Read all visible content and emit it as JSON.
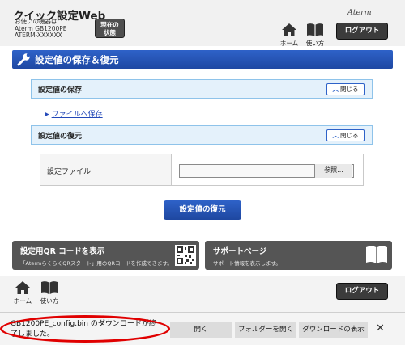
{
  "header": {
    "title": "クイック設定Web",
    "device_line1": "お使いの機器は",
    "device_line2": "Aterm GB1200PE",
    "device_line3": "ATERM-XXXXXX",
    "status_line1": "現在の",
    "status_line2": "状態",
    "home_label": "ホーム",
    "manual_label": "使い方",
    "brand": "Aterm",
    "logout_label": "ログアウト"
  },
  "panel": {
    "title": "設定値の保存＆復元"
  },
  "save_section": {
    "title": "設定値の保存",
    "close_label": "閉じる",
    "link": "ファイルへ保存"
  },
  "restore_section": {
    "title": "設定値の復元",
    "close_label": "閉じる",
    "file_label": "設定ファイル",
    "file_value": "",
    "browse_label": "参照...",
    "restore_button": "設定値の復元"
  },
  "qr_button": {
    "title": "設定用QR コードを表示",
    "desc": "「AtermらくらくQRスタート」用のQRコードを作成できます。"
  },
  "support_button": {
    "title": "サポートページ",
    "desc": "サポート情報を表示します。"
  },
  "footer": {
    "home_label": "ホーム",
    "manual_label": "使い方",
    "logout_label": "ログアウト"
  },
  "download_bar": {
    "message_line1": "GB1200PE_config.bin のダウンロードが終",
    "message_line2": "了しました。",
    "open_label": "開く",
    "open_folder_label": "フォルダーを開く",
    "show_downloads_label": "ダウンロードの表示",
    "close_symbol": "✕"
  },
  "colors": {
    "accent": "#2e62c8",
    "section_bg": "#e4f1fb",
    "dark_button": "#555555",
    "annotation": "#e00000"
  }
}
